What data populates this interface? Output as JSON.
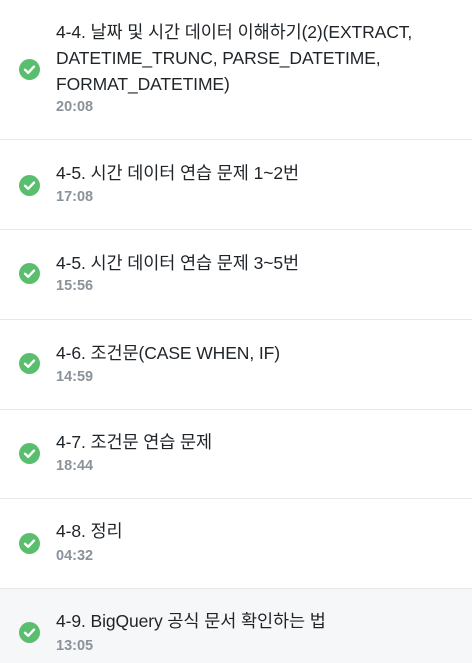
{
  "lessons": [
    {
      "title": "4-4. 날짜 및 시간 데이터 이해하기(2)(EXTRACT, DATETIME_TRUNC, PARSE_DATETIME, FORMAT_DATETIME)",
      "duration": "20:08",
      "status_color": "#5bbd6e",
      "icon": "check-circle-icon"
    },
    {
      "title": "4-5. 시간 데이터 연습 문제 1~2번",
      "duration": "17:08",
      "status_color": "#5bbd6e",
      "icon": "check-circle-icon"
    },
    {
      "title": "4-5. 시간 데이터 연습 문제 3~5번",
      "duration": "15:56",
      "status_color": "#5bbd6e",
      "icon": "check-circle-icon"
    },
    {
      "title": "4-6. 조건문(CASE WHEN, IF)",
      "duration": "14:59",
      "status_color": "#5bbd6e",
      "icon": "check-circle-icon"
    },
    {
      "title": "4-7. 조건문 연습 문제",
      "duration": "18:44",
      "status_color": "#5bbd6e",
      "icon": "check-circle-icon"
    },
    {
      "title": "4-8. 정리",
      "duration": "04:32",
      "status_color": "#5bbd6e",
      "icon": "check-circle-icon"
    },
    {
      "title": "4-9. BigQuery 공식 문서 확인하는 법",
      "duration": "13:05",
      "status_color": "#5bbd6e",
      "icon": "check-circle-icon"
    }
  ]
}
